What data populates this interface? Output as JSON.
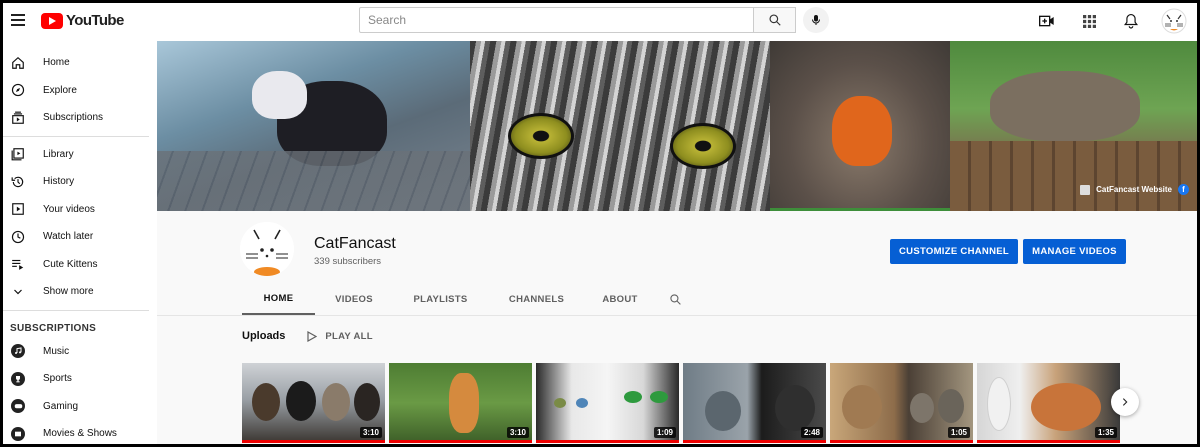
{
  "app": {
    "logo_text": "YouTube",
    "search_placeholder": "Search",
    "brand_color": "#ff0000",
    "accent_color": "#065fd4"
  },
  "topbar": {
    "icons": [
      "menu-icon",
      "search-icon",
      "mic-icon",
      "create-video-icon",
      "apps-icon",
      "bell-icon",
      "account-avatar"
    ]
  },
  "sidebar": {
    "items": [
      {
        "label": "Home",
        "icon": "home-icon"
      },
      {
        "label": "Explore",
        "icon": "compass-icon"
      },
      {
        "label": "Subscriptions",
        "icon": "subscriptions-icon"
      },
      {
        "label": "Library",
        "icon": "library-icon"
      },
      {
        "label": "History",
        "icon": "history-icon"
      },
      {
        "label": "Your videos",
        "icon": "your-videos-icon"
      },
      {
        "label": "Watch later",
        "icon": "clock-icon"
      },
      {
        "label": "Cute Kittens",
        "icon": "playlist-icon"
      },
      {
        "label": "Show more",
        "icon": "chevron-down-icon"
      }
    ],
    "subscriptions_heading": "SUBSCRIPTIONS",
    "subscriptions": [
      {
        "label": "Music",
        "icon": "music-icon"
      },
      {
        "label": "Sports",
        "icon": "trophy-icon"
      },
      {
        "label": "Gaming",
        "icon": "gamepad-icon"
      },
      {
        "label": "Movies & Shows",
        "icon": "film-icon"
      }
    ]
  },
  "banner": {
    "website_link": "CatFancast Website"
  },
  "channel": {
    "name": "CatFancast",
    "subscribers": "339 subscribers",
    "customize_label": "CUSTOMIZE CHANNEL",
    "manage_label": "MANAGE VIDEOS"
  },
  "tabs": [
    "HOME",
    "VIDEOS",
    "PLAYLISTS",
    "CHANNELS",
    "ABOUT"
  ],
  "uploads": {
    "title": "Uploads",
    "play_all": "PLAY ALL",
    "videos": [
      {
        "duration": "3:10"
      },
      {
        "duration": "3:10"
      },
      {
        "duration": "1:09"
      },
      {
        "duration": "2:48"
      },
      {
        "duration": "1:05"
      },
      {
        "duration": "1:35"
      }
    ]
  }
}
